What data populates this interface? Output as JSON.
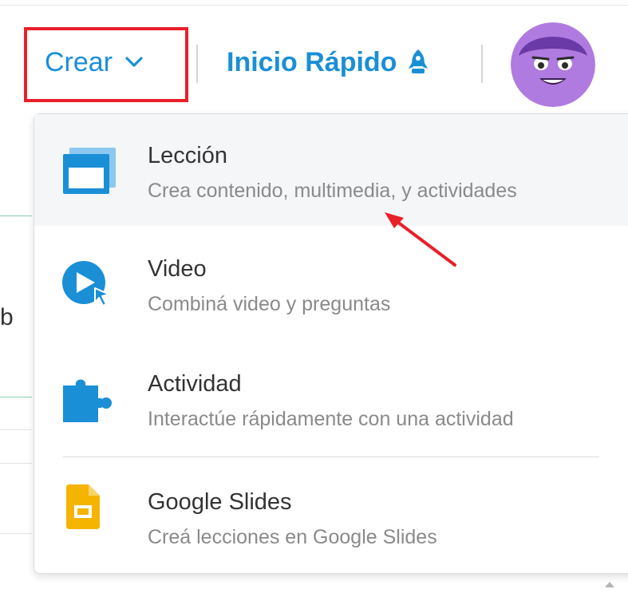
{
  "header": {
    "create_label": "Crear",
    "quick_start_label": "Inicio Rápido"
  },
  "menu": {
    "items": [
      {
        "title": "Lección",
        "description": "Crea contenido, multimedia, y actividades",
        "icon": "window-stack-icon"
      },
      {
        "title": "Video",
        "description": "Combiná video y preguntas",
        "icon": "video-play-icon"
      },
      {
        "title": "Actividad",
        "description": "Interactúe rápidamente con una actividad",
        "icon": "puzzle-icon"
      },
      {
        "title": "Google Slides",
        "description": "Creá lecciones en Google Slides",
        "icon": "google-slides-icon"
      }
    ]
  },
  "background": {
    "partial_letter": "b"
  },
  "colors": {
    "accent": "#1a8fd6",
    "highlight": "#e8202a",
    "slides": "#f4b400",
    "avatar": "#b07be0"
  }
}
